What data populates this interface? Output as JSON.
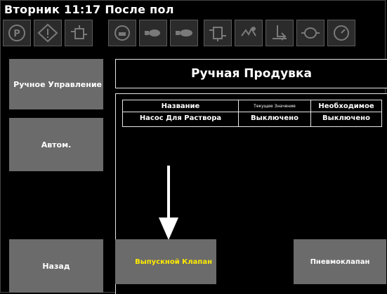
{
  "header": {
    "day": "Вторник",
    "time": "11:17",
    "status": "После пол"
  },
  "toolbar": {
    "icons": [
      "park-icon",
      "warning-icon",
      "cooling-tower-icon",
      "tank-icon",
      "pump-icon",
      "pump-icon-2",
      "filter-icon",
      "heater-icon",
      "valve-icon",
      "dosing-icon",
      "gauge-icon"
    ]
  },
  "sidebar": {
    "manual_label": "Ручное Управление",
    "auto_label": "Автом.",
    "back_label": "Назад"
  },
  "main": {
    "title": "Ручная Продувка",
    "table": {
      "headers": [
        "Название",
        "Текущее Значение",
        "Необходимое"
      ],
      "rows": [
        [
          "Насос Для Раствора",
          "Выключено",
          "Выключено"
        ]
      ]
    },
    "buttons": {
      "drain_valve": "Выпускной Клапан",
      "pneumatic_valve": "Пневмоклапан"
    }
  },
  "colors": {
    "background": "#000000",
    "button_gray": "#6b6b6b",
    "highlight_yellow": "#ffeb00",
    "border": "#e6e6e6"
  }
}
